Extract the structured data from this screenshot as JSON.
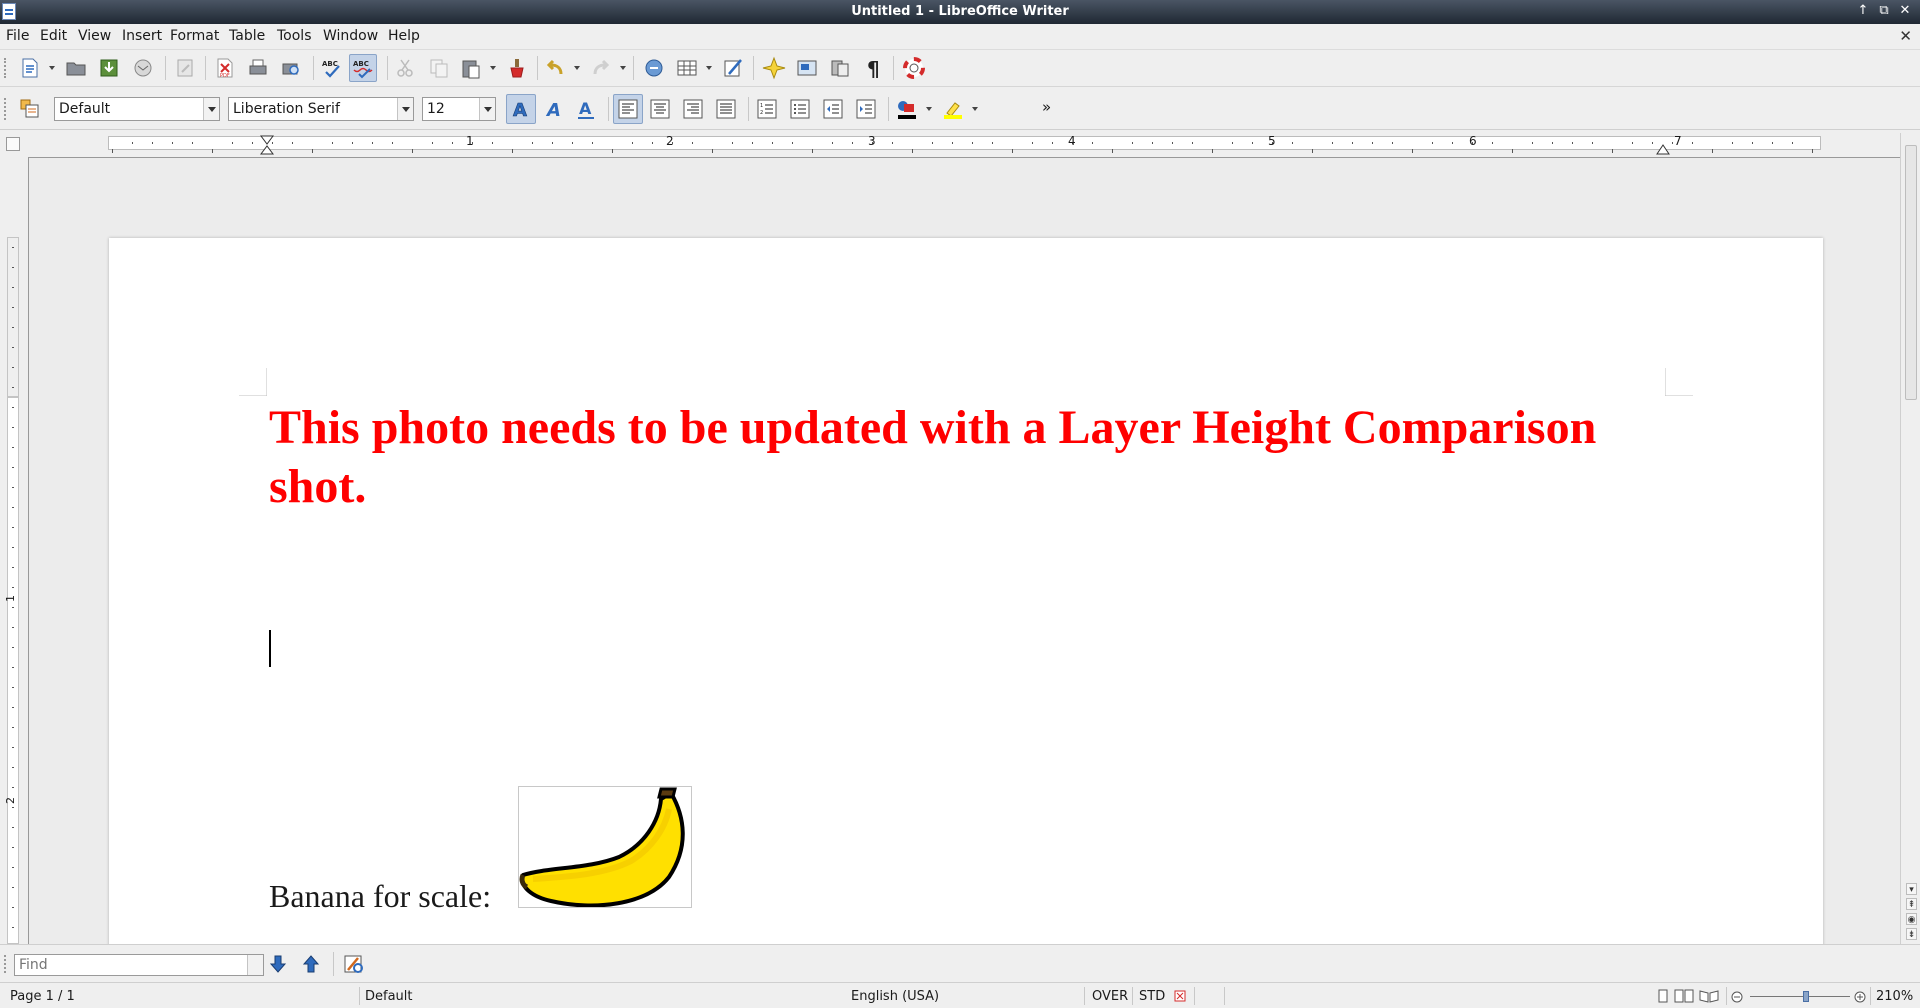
{
  "window": {
    "title": "Untitled 1 - LibreOffice Writer"
  },
  "menu": [
    {
      "label": "File",
      "name": "file"
    },
    {
      "label": "Edit",
      "name": "edit"
    },
    {
      "label": "View",
      "name": "view"
    },
    {
      "label": "Insert",
      "name": "insert"
    },
    {
      "label": "Format",
      "name": "format"
    },
    {
      "label": "Table",
      "name": "table"
    },
    {
      "label": "Tools",
      "name": "tools"
    },
    {
      "label": "Window",
      "name": "window"
    },
    {
      "label": "Help",
      "name": "help"
    }
  ],
  "formatting": {
    "paragraph_style": "Default",
    "font_name": "Liberation Serif",
    "font_size": "12",
    "more_label": "»"
  },
  "ruler": {
    "h_numbers": [
      "1",
      "2",
      "3",
      "4",
      "5",
      "6",
      "7"
    ],
    "v_numbers": [
      "1",
      "2"
    ]
  },
  "document": {
    "heading": "This photo needs to be updated with a Layer Height Comparison shot.",
    "heading_color": "#ff0000",
    "caption": "Banana for scale:"
  },
  "findbar": {
    "placeholder": "Find"
  },
  "status": {
    "page": "Page 1 / 1",
    "style": "Default",
    "language": "English (USA)",
    "mode": "OVER",
    "selection_mode": "STD",
    "zoom": "210%"
  }
}
